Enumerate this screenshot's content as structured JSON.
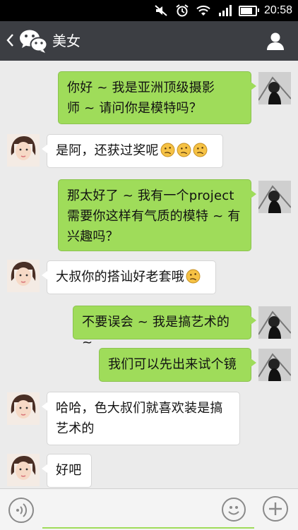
{
  "status_bar": {
    "time": "20:58",
    "icons": [
      "mute-icon",
      "alarm-icon",
      "wifi-icon",
      "signal-icon",
      "battery-icon"
    ],
    "battery_level": 0.75
  },
  "header": {
    "title": "美女",
    "back_icon": "chevron-left-icon",
    "app_icon": "wechat-icon",
    "profile_icon": "contact-icon"
  },
  "colors": {
    "header_bg": "#3c3e43",
    "sent_bubble": "#9fdc5a",
    "received_bubble": "#ffffff",
    "chat_bg": "#ebebeb"
  },
  "messages": [
    {
      "sender": "me",
      "lines": [
        "你好 ~ 我是亚洲顶级摄影",
        "师 ~ 请问你是模特吗？"
      ]
    },
    {
      "sender": "her",
      "lines": [
        "是阿，还获过奖呢"
      ],
      "emoji_count": 3
    },
    {
      "sender": "me",
      "lines": [
        "那太好了 ~ 我有一个project",
        "需要你这样有气质的模特 ~ 有",
        "兴趣吗？"
      ]
    },
    {
      "sender": "her",
      "lines": [
        "大叔你的搭讪好老套哦"
      ],
      "emoji_count": 1
    },
    {
      "sender": "me",
      "lines": [
        "不要误会 ~ 我是搞艺术的 ~"
      ]
    },
    {
      "sender": "me",
      "lines": [
        "我们可以先出来试个镜"
      ]
    },
    {
      "sender": "her",
      "lines": [
        "哈哈，色大叔们就喜欢装是搞",
        "艺术的"
      ]
    },
    {
      "sender": "her",
      "lines": [
        "好吧"
      ]
    }
  ],
  "input_bar": {
    "value": "",
    "voice_icon": "voice-icon",
    "emoji_icon": "emoji-icon",
    "plus_icon": "plus-icon"
  }
}
